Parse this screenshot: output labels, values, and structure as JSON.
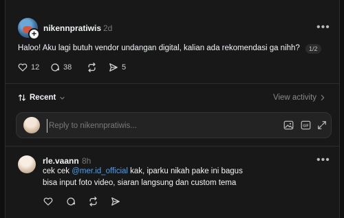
{
  "post": {
    "username": "nikennpratiwis",
    "timestamp": "2d",
    "text": "Haloo! Aku lagi butuh vendor undangan digital, kalian ada rekomendasi ga nihh?",
    "page_indicator": "1/2",
    "likes": "12",
    "comments": "38",
    "shares": "5",
    "more_label": "•••"
  },
  "replies_header": {
    "sort_label": "Recent",
    "view_activity_label": "View activity"
  },
  "reply_box": {
    "placeholder": "Reply to nikennpratiwis..."
  },
  "comment": {
    "username": "rle.vaann",
    "timestamp": "8h",
    "line1_before": "cek cek ",
    "mention": "@mer.id_official",
    "line1_after": " kak, iparku nikah pake ini bagus",
    "line2": "bisa input foto video, siaran langsung dan custom tema",
    "more_label": "•••"
  },
  "colors": {
    "background": "#101010",
    "card": "#181818",
    "mention": "#4aa0f3"
  }
}
